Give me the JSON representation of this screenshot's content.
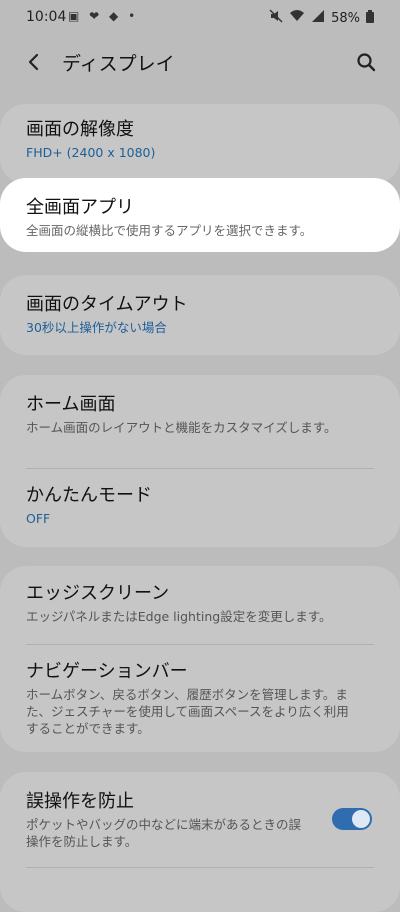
{
  "status_bar": {
    "time": "10:04",
    "left_icons": "▣ ❤ ◆ •",
    "battery": "58%"
  },
  "app_bar": {
    "title": "ディスプレイ"
  },
  "items": {
    "resolution": {
      "title": "画面の解像度",
      "sub": "FHD+ (2400 x 1080)"
    },
    "fullscreen": {
      "title": "全画面アプリ",
      "sub": "全画面の縦横比で使用するアプリを選択できます。"
    },
    "timeout": {
      "title": "画面のタイムアウト",
      "sub": "30秒以上操作がない場合"
    },
    "home": {
      "title": "ホーム画面",
      "sub": "ホーム画面のレイアウトと機能をカスタマイズします。"
    },
    "easy": {
      "title": "かんたんモード",
      "sub": "OFF"
    },
    "edge": {
      "title": "エッジスクリーン",
      "sub": "エッジパネルまたはEdge lighting設定を変更します。"
    },
    "navbar": {
      "title": "ナビゲーションバー",
      "sub": "ホームボタン、戻るボタン、履歴ボタンを管理します。また、ジェスチャーを使用して画面スペースをより広く利用することができます。"
    },
    "accidental": {
      "title": "誤操作を防止",
      "sub": "ポケットやバッグの中などに端末があるときの誤操作を防止します。",
      "toggle_on": true
    }
  },
  "colors": {
    "accent": "#2f6db0",
    "link_text": "#1d5f98",
    "overlay_bg": "#bcbcbc"
  }
}
